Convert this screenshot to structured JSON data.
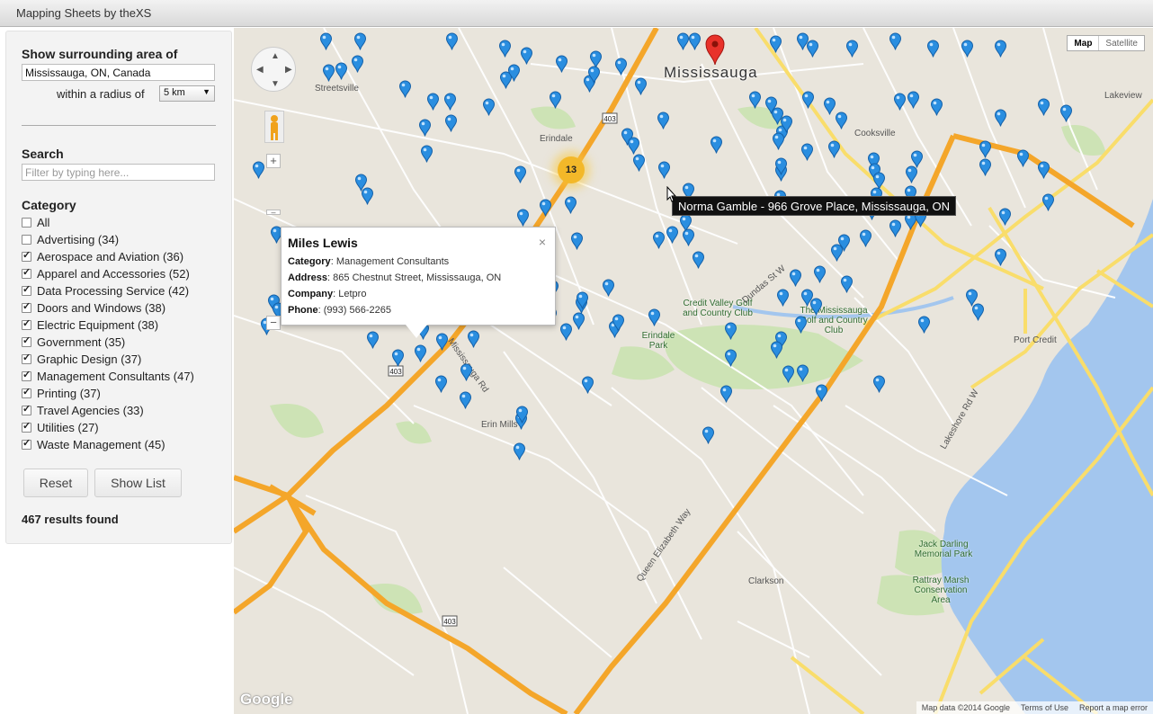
{
  "window": {
    "title": "Mapping Sheets by theXS"
  },
  "sidebar": {
    "surrounding_title": "Show surrounding area of",
    "location_value": "Mississauga, ON, Canada",
    "radius_label": "within a radius of",
    "radius_value": "5 km",
    "search_title": "Search",
    "search_placeholder": "Filter by typing here...",
    "category_title": "Category",
    "categories": [
      {
        "label": "All",
        "checked": false
      },
      {
        "label": "Advertising (34)",
        "checked": false
      },
      {
        "label": "Aerospace and Aviation (36)",
        "checked": true
      },
      {
        "label": "Apparel and Accessories (52)",
        "checked": true
      },
      {
        "label": "Data Processing Service (42)",
        "checked": true
      },
      {
        "label": "Doors and Windows (38)",
        "checked": true
      },
      {
        "label": "Electric Equipment (38)",
        "checked": true
      },
      {
        "label": "Government (35)",
        "checked": true
      },
      {
        "label": "Graphic Design (37)",
        "checked": true
      },
      {
        "label": "Management Consultants (47)",
        "checked": true
      },
      {
        "label": "Printing (37)",
        "checked": true
      },
      {
        "label": "Travel Agencies (33)",
        "checked": true
      },
      {
        "label": "Utilities (27)",
        "checked": true
      },
      {
        "label": "Waste Management (45)",
        "checked": true
      }
    ],
    "reset_label": "Reset",
    "show_list_label": "Show List",
    "results_text": "467 results found"
  },
  "map": {
    "type_map": "Map",
    "type_satellite": "Satellite",
    "city_label": "Mississauga",
    "cluster_count": "13",
    "tooltip_text": "Norma Gamble - 966 Grove Place, Mississauga, ON",
    "info_window": {
      "name": "Miles Lewis",
      "category_key": "Category",
      "category_value": "Management Consultants",
      "address_key": "Address",
      "address_value": "865 Chestnut Street, Mississauga, ON",
      "company_key": "Company",
      "company_value": "Letpro",
      "phone_key": "Phone",
      "phone_value": "(993) 566-2265",
      "close_glyph": "×"
    },
    "labels": {
      "credit_valley": "Credit Valley Golf and Country Club",
      "mississauga_golf": "The Mississauga Golf and Country Club",
      "erindale_park": "Erindale Park",
      "jack_darling": "Jack Darling Memorial Park",
      "rattray": "Rattray Marsh Conservation Area",
      "erin_mills": "Erin Mills",
      "clarkson": "Clarkson",
      "port_credit": "Port Credit",
      "cooksville": "Cooksville",
      "lakeview": "Lakeview",
      "erindale": "Erindale",
      "streetsville": "Streetsville",
      "queen_elizabeth": "Queen Elizabeth Way",
      "lakeshore": "Lakeshore Rd W",
      "dundas": "Dundas St W",
      "mississauga_rd": "Mississauga Rd"
    },
    "route_badges": [
      "403",
      "403",
      "403"
    ],
    "google_logo": "Google",
    "attribution": [
      "Map data ©2014 Google",
      "Terms of Use",
      "Report a map error"
    ],
    "colors": {
      "highway": "#f4a62a",
      "arterial": "#f9dd6b",
      "water": "#a3c6ee",
      "park": "#cde3b5",
      "pin": "#2a8ee0",
      "red_pin": "#e8322a"
    }
  }
}
